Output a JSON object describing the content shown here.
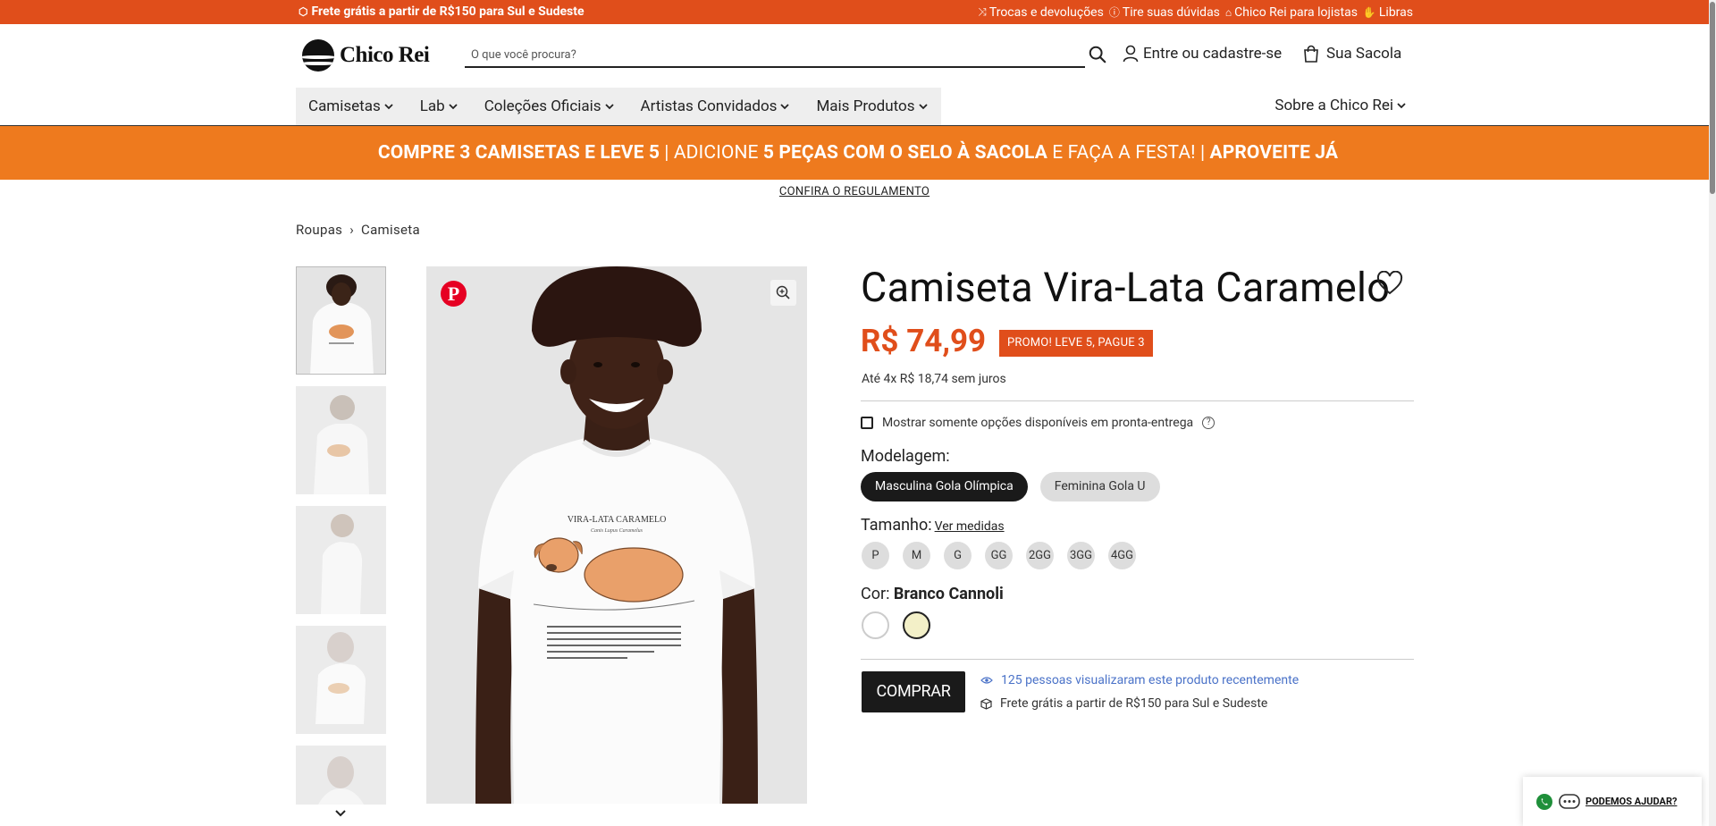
{
  "topbar": {
    "shipping": "Frete grátis a partir de R$150 para Sul e Sudeste",
    "links": [
      "Trocas e devoluções",
      "Tire suas dúvidas",
      "Chico Rei para lojistas",
      "Libras"
    ]
  },
  "header": {
    "logo_text": "Chico Rei",
    "search_placeholder": "O que você procura?",
    "login": "Entre ou cadastre-se",
    "bag": "Sua Sacola"
  },
  "nav": {
    "items": [
      "Camisetas",
      "Lab",
      "Coleções Oficiais",
      "Artistas Convidados",
      "Mais Produtos"
    ],
    "right": "Sobre a Chico Rei"
  },
  "promo": {
    "part1": "COMPRE 3 CAMISETAS E LEVE 5",
    "part2": " | ADICIONE ",
    "part3": "5 PEÇAS COM O SELO À SACOLA",
    "part4": " E FAÇA A FESTA! | ",
    "part5": "APROVEITE JÁ",
    "rules": "CONFIRA O REGULAMENTO"
  },
  "breadcrumb": [
    "Roupas",
    "Camiseta"
  ],
  "product": {
    "title": "Camiseta Vira-Lata Caramelo",
    "price": "R$ 74,99",
    "badge": "PROMO! LEVE 5, PAGUE 3",
    "installments": "Até 4x R$ 18,74 sem juros",
    "stock_filter": "Mostrar somente opções disponíveis em pronta-entrega",
    "model_label": "Modelagem:",
    "models": [
      "Masculina Gola Olímpica",
      "Feminina Gola U"
    ],
    "size_label": "Tamanho:",
    "size_chart": "Ver medidas",
    "sizes": [
      "P",
      "M",
      "G",
      "GG",
      "2GG",
      "3GG",
      "4GG"
    ],
    "color_label": "Cor:",
    "color_name": "Branco Cannoli",
    "swatches": [
      "#ffffff",
      "#f3f0c8"
    ],
    "buy": "COMPRAR",
    "views": "125 pessoas visualizaram este produto recentemente",
    "shipping": "Frete grátis a partir de R$150 para Sul e Sudeste"
  },
  "shirt_print": {
    "title": "VIRA-LATA CARAMELO",
    "subtitle": "Canis Lupus Caramelus"
  },
  "help": {
    "label": "PODEMOS AJUDAR?"
  },
  "colors": {
    "accent": "#e04e1b",
    "promo_bg": "#ee7a1e",
    "link": "#4a72c8"
  }
}
